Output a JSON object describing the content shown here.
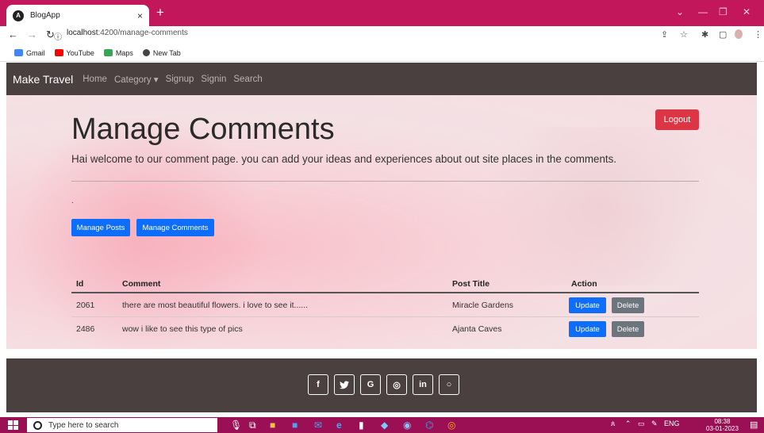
{
  "browser": {
    "tab_title": "BlogApp",
    "tab_close": "×",
    "new_tab": "+",
    "url_host": "localhost",
    "url_path": ":4200/manage-comments",
    "bookmarks": [
      {
        "label": "Gmail",
        "icon": "gmail-icon",
        "color": "#4285f4"
      },
      {
        "label": "YouTube",
        "icon": "youtube-icon",
        "color": "#ff0000"
      },
      {
        "label": "Maps",
        "icon": "maps-icon",
        "color": "#34a853"
      },
      {
        "label": "New Tab",
        "icon": "new-tab-icon",
        "color": "#444444"
      }
    ]
  },
  "site": {
    "brand": "Make Travel",
    "nav": [
      "Home",
      "Category ▾",
      "Signup",
      "Signin",
      "Search"
    ],
    "logout_label": "Logout",
    "page_title": "Manage Comments",
    "welcome_text": "Hai welcome to our comment page. you can add your ideas and experiences about out site places in the comments.",
    "dot": ".",
    "manage_posts_label": "Manage Posts",
    "manage_comments_label": "Manage Comments",
    "table": {
      "headers": {
        "id": "Id",
        "comment": "Comment",
        "post_title": "Post Title",
        "action": "Action"
      },
      "rows": [
        {
          "id": "2061",
          "comment": "there are most beautiful flowers. i love to see it......",
          "post_title": "Miracle Gardens"
        },
        {
          "id": "2486",
          "comment": "wow i like to see this type of pics",
          "post_title": "Ajanta Caves"
        }
      ],
      "update_label": "Update",
      "delete_label": "Delete"
    },
    "social": [
      "f",
      "🐦",
      "G",
      "◎",
      "in",
      "○"
    ]
  },
  "taskbar": {
    "search_placeholder": "Type here to search",
    "tray_lang": "ENG",
    "time": "08:38",
    "date": "03-01-2023"
  },
  "colors": {
    "tab_strip": "#c2185b",
    "navbar": "#4a4040",
    "primary": "#0d6efd",
    "danger": "#dc3545",
    "secondary": "#6c757d",
    "taskbar": "#9b1054"
  }
}
